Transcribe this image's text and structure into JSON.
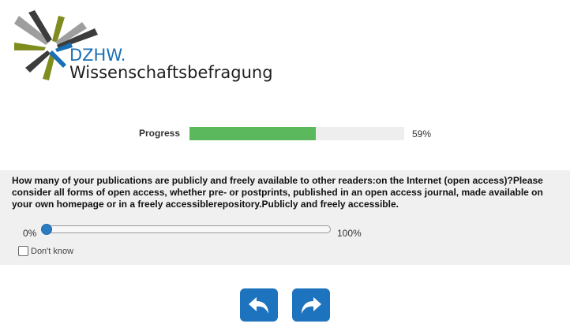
{
  "logo": {
    "brand": "DZHW.",
    "subtitle": "Wissenschaftsbefragung",
    "colors": [
      "#7f8c1e",
      "#3c3c3c",
      "#9e9e9e",
      "#1a6fb4"
    ]
  },
  "progress": {
    "label": "Progress",
    "percent": 59,
    "value_text": "59%",
    "fill_color": "#5cb85c"
  },
  "question": {
    "text": "How many of your publications are publicly and freely available to other readers:on the Internet (open access)?Please consider all forms of open access, whether pre- or postprints, published in an open access journal, made available on your own homepage or in a freely accessiblerepository.Publicly and freely accessible.",
    "slider": {
      "min_label": "0%",
      "max_label": "100%",
      "value": 0
    },
    "dont_know": {
      "label": "Don't know",
      "checked": false
    }
  },
  "navigation": {
    "back_icon": "back-arrow-icon",
    "next_icon": "forward-arrow-icon",
    "color": "#1d73bd"
  }
}
